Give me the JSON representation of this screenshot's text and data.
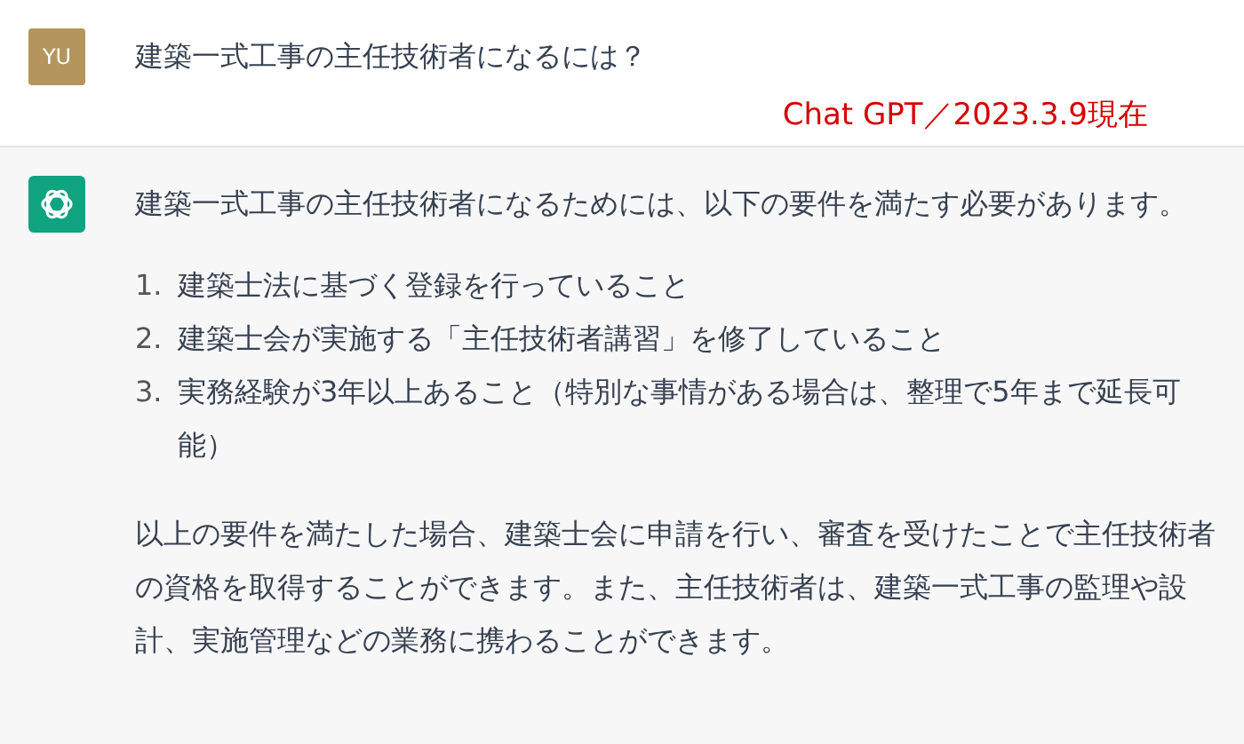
{
  "question": {
    "avatar": "YU",
    "text": "建築一式工事の主任技術者になるには？"
  },
  "annotation": "Chat GPT／2023.3.9現在",
  "answer": {
    "intro": "建築一式工事の主任技術者になるためには、以下の要件を満たす必要があります。",
    "list": [
      {
        "number": "1.",
        "text": "建築士法に基づく登録を行っていること"
      },
      {
        "number": "2.",
        "text": "建築士会が実施する「主任技術者講習」を修了していること"
      },
      {
        "number": "3.",
        "text": "実務経験が3年以上あること（特別な事情がある場合は、整理で5年まで延長可能）"
      }
    ],
    "paragraph": "以上の要件を満たした場合、建築士会に申請を行い、審査を受けたことで主任技術者の資格を取得することができます。また、主任技術者は、建築一式工事の監理や設計、実施管理などの業務に携わることができます。"
  }
}
